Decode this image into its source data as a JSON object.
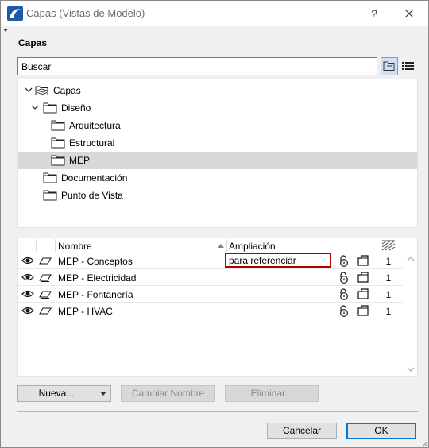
{
  "window": {
    "title": "Capas (Vistas de Modelo)",
    "help_label": "?",
    "section_title": "Capas"
  },
  "search": {
    "placeholder": "Buscar",
    "value": ""
  },
  "tree": {
    "items": [
      {
        "label": "Capas",
        "level": 0,
        "expanded": true
      },
      {
        "label": "Diseño",
        "level": 1,
        "expanded": true
      },
      {
        "label": "Arquitectura",
        "level": 2
      },
      {
        "label": "Estructural",
        "level": 2
      },
      {
        "label": "MEP",
        "level": 2,
        "selected": true
      },
      {
        "label": "Documentación",
        "level": 1
      },
      {
        "label": "Punto de Vista",
        "level": 1
      }
    ]
  },
  "layers": {
    "columns": {
      "name": "Nombre",
      "extension": "Ampliación"
    },
    "rows": [
      {
        "name": "MEP - Conceptos",
        "extension": "para referenciar",
        "intersection_group": "1"
      },
      {
        "name": "MEP - Electricidad",
        "extension": "",
        "intersection_group": "1"
      },
      {
        "name": "MEP - Fontanería",
        "extension": "",
        "intersection_group": "1"
      },
      {
        "name": "MEP - HVAC",
        "extension": "",
        "intersection_group": "1"
      }
    ]
  },
  "buttons": {
    "new": "Nueva...",
    "rename": "Cambiar Nombre",
    "delete": "Eliminar...",
    "cancel": "Cancelar",
    "ok": "OK"
  },
  "colors": {
    "highlight_border": "#b00000",
    "selected_row": "#d8d8d8",
    "primary_border": "#0078d7"
  },
  "icons": {
    "app": "archicad-icon",
    "close": "close-icon",
    "tree_view": "tree-view-icon",
    "list_view": "list-view-icon",
    "folder": "folder-icon",
    "eye": "eye-icon",
    "layer": "layer-icon",
    "lock": "lock-icon",
    "wireframe": "wireframe-icon"
  }
}
